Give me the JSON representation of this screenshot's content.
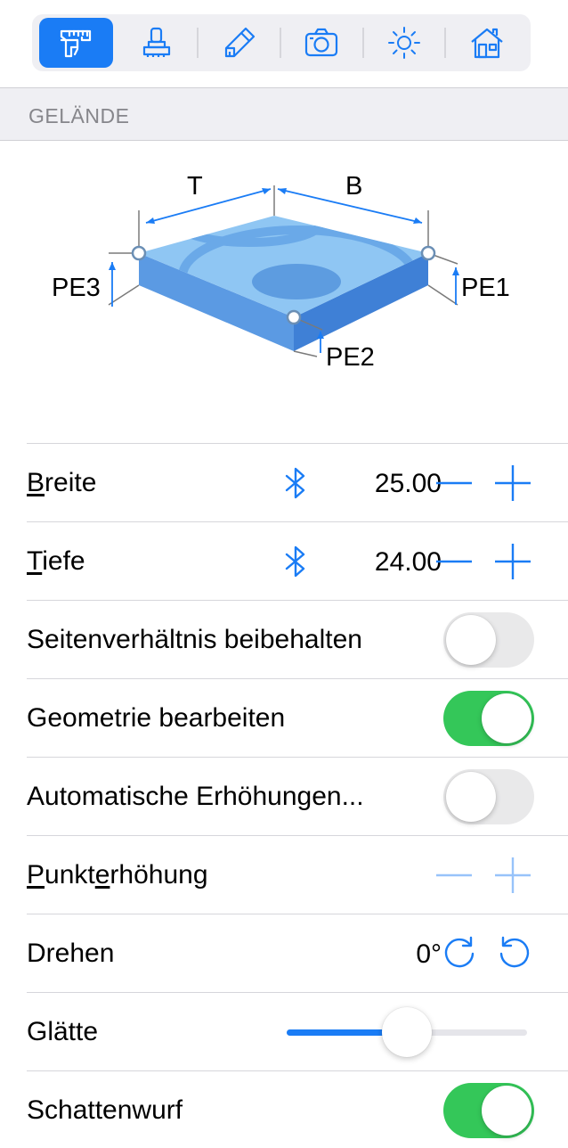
{
  "toolbar": {
    "tools": [
      {
        "icon": "caliper-icon",
        "active": true
      },
      {
        "icon": "stamp-icon",
        "active": false
      },
      {
        "icon": "pencil-icon",
        "active": false
      },
      {
        "icon": "camera-icon",
        "active": false
      },
      {
        "icon": "sun-icon",
        "active": false
      },
      {
        "icon": "house-icon",
        "active": false
      }
    ]
  },
  "section": {
    "title": "GELÄNDE"
  },
  "diagram": {
    "label_t": "T",
    "label_b": "B",
    "label_pe1": "PE1",
    "label_pe2": "PE2",
    "label_pe3": "PE3"
  },
  "rows": {
    "breite": {
      "label_first": "B",
      "label_rest": "reite",
      "value": "25.00",
      "icon": "bluetooth-icon"
    },
    "tiefe": {
      "label_first": "T",
      "label_rest": "iefe",
      "value": "24.00",
      "icon": "bluetooth-icon"
    },
    "seitenverhaeltnis": {
      "label": "Seitenverhältnis beibehalten",
      "on": false
    },
    "geometrie": {
      "label": "Geometrie bearbeiten",
      "on": true
    },
    "automatische": {
      "label": "Automatische Erhöhungen...",
      "on": false
    },
    "punkterhoehung": {
      "label_p": "P",
      "label_mid": "unkt",
      "label_e": "e",
      "label_rest": "rhöhung",
      "enabled": false
    },
    "drehen": {
      "label": "Drehen",
      "value": "0°"
    },
    "glaette": {
      "label": "Glätte",
      "value": 0.5
    },
    "schattenwurf": {
      "label": "Schattenwurf",
      "on": true
    }
  },
  "colors": {
    "accent": "#1a7cf5",
    "toggle_on": "#34c759",
    "toggle_off": "#e9e9ea"
  }
}
